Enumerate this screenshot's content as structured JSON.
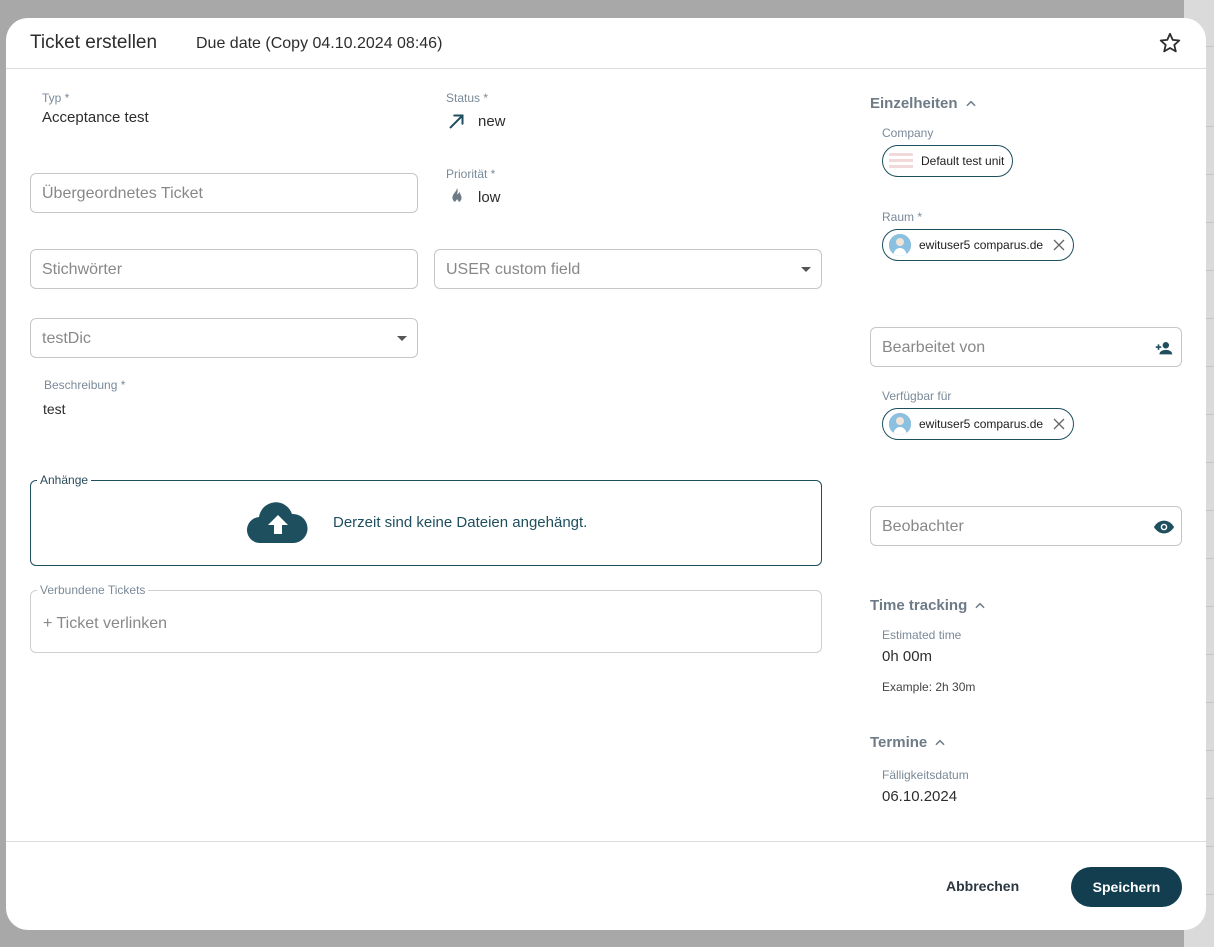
{
  "header": {
    "title": "Ticket erstellen",
    "subtitle": "Due date (Copy 04.10.2024 08:46)"
  },
  "form": {
    "typ_label": "Typ *",
    "typ_value": "Acceptance test",
    "status_label": "Status *",
    "status_value": "new",
    "parent_placeholder": "Übergeordnetes Ticket",
    "prioritaet_label": "Priorität *",
    "prioritaet_value": "low",
    "tags_placeholder": "Stichwörter",
    "user_custom_placeholder": "USER custom field",
    "testdic_placeholder": "testDic",
    "beschreibung_label": "Beschreibung *",
    "beschreibung_value": "test",
    "anhaenge_label": "Anhänge",
    "anhaenge_empty": "Derzeit sind keine Dateien angehängt.",
    "linked_label": "Verbundene Tickets",
    "linked_action": "+ Ticket verlinken"
  },
  "details": {
    "title": "Einzelheiten",
    "company_label": "Company",
    "company_value": "Default test unit",
    "raum_label": "Raum *",
    "raum_value": "ewituser5 comparus.de",
    "bearbeitet_placeholder": "Bearbeitet von",
    "verfuegbar_label": "Verfügbar für",
    "verfuegbar_value": "ewituser5 comparus.de",
    "beobachter_placeholder": "Beobachter"
  },
  "time_tracking": {
    "title": "Time tracking",
    "estimated_label": "Estimated time",
    "estimated_value": "0h 00m",
    "example": "Example: 2h 30m"
  },
  "termine": {
    "title": "Termine",
    "due_label": "Fälligkeitsdatum",
    "due_value": "06.10.2024"
  },
  "footer": {
    "cancel": "Abbrechen",
    "save": "Speichern"
  },
  "colors": {
    "primary": "#123e50",
    "accent": "#1e4f5f"
  }
}
